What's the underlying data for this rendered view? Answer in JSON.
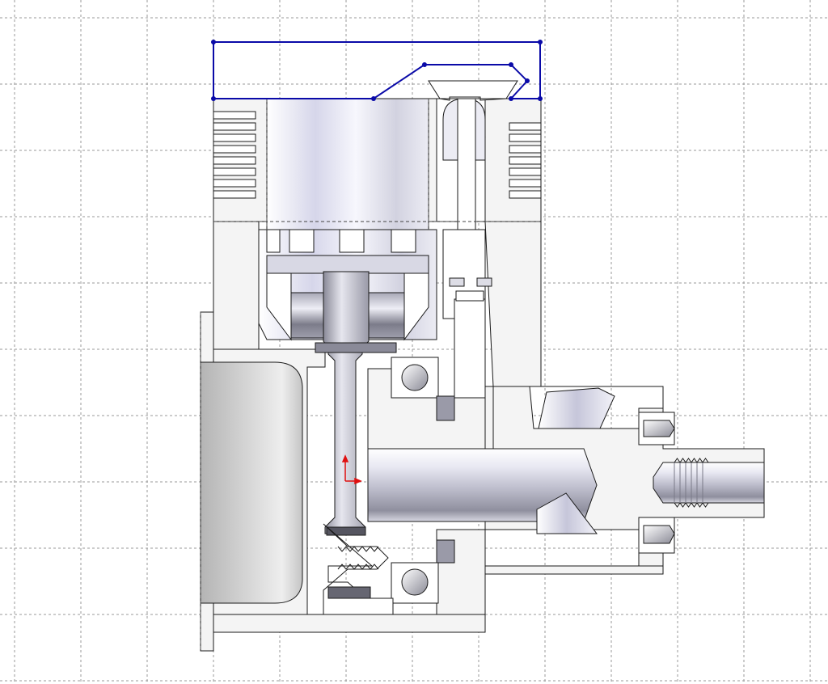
{
  "viewport": {
    "background": "#ffffff",
    "grid": {
      "visible": true,
      "line_style": "dashed",
      "color": "#9a9a9a"
    }
  },
  "drawing": {
    "type": "engine-cross-section",
    "colors": {
      "outline": "#1a1a1a",
      "hidden_line": "#444444",
      "section_fill": "#f4f4f4",
      "metal_light": "#f2f2f8",
      "metal_mid": "#c9c9d8",
      "metal_dark": "#7a7a88",
      "sketch_line": "#0a0aa8",
      "sketch_point": "#0a0aa8",
      "origin_axis": "#e01010"
    },
    "sketch": {
      "closed": true,
      "point_count": 9
    }
  }
}
